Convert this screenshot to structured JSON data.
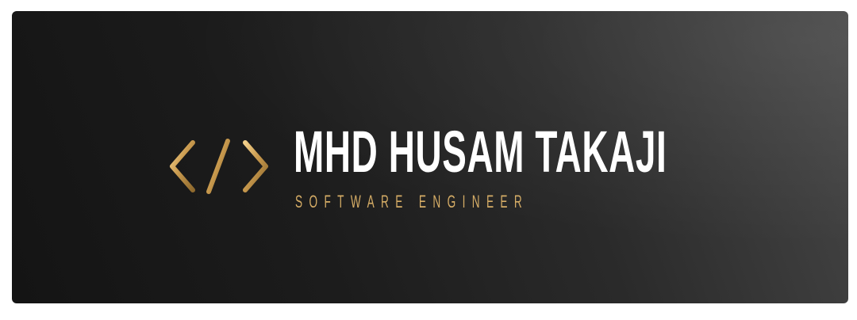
{
  "banner": {
    "name": "MHD HUSAM TAKAJI",
    "role": "SOFTWARE ENGINEER",
    "icon": "code-brackets-icon",
    "colors": {
      "text": "#ffffff",
      "accent_gold": "#d6ad66",
      "background_dark": "#141414",
      "background_light": "#474747"
    }
  }
}
